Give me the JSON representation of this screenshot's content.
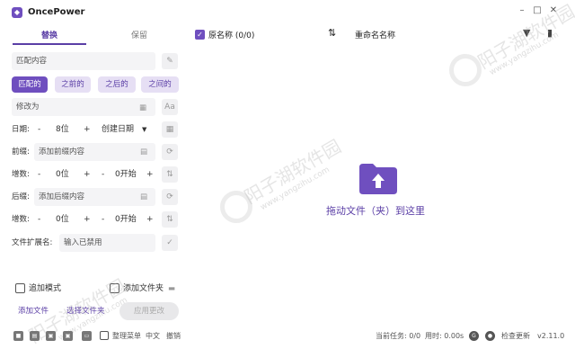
{
  "app": {
    "title": "OncePower"
  },
  "tabs": [
    "替换",
    "保留"
  ],
  "left": {
    "match_placeholder": "匹配内容",
    "mode_buttons": [
      "匹配的",
      "之前的",
      "之后的",
      "之间的"
    ],
    "modify_placeholder": "修改为",
    "date": {
      "label": "日期:",
      "minus": "-",
      "value": "8位",
      "plus": "+",
      "select": "创建日期"
    },
    "prefix": {
      "label": "前缀:",
      "placeholder": "添加前缀内容"
    },
    "increment1": {
      "label": "增数:",
      "minus1": "-",
      "value1": "0位",
      "plus1": "+",
      "minus2": "-",
      "value2": "0开始",
      "plus2": "+"
    },
    "suffix": {
      "label": "后缀:",
      "placeholder": "添加后缀内容"
    },
    "increment2": {
      "label": "增数:",
      "minus1": "-",
      "value1": "0位",
      "plus1": "+",
      "minus2": "-",
      "value2": "0开始",
      "plus2": "+"
    },
    "extension": {
      "label": "文件扩展名:",
      "placeholder": "输入已禁用"
    },
    "append_mode": "追加模式",
    "add_folder": "添加文件夹",
    "add_file": "添加文件",
    "select_folder": "选择文件夹",
    "apply": "应用更改"
  },
  "right": {
    "original_name": "原名称 (0/0)",
    "rename_name": "重命名名称",
    "drop_text": "拖动文件（夹）到这里"
  },
  "status": {
    "organize": "整理菜单",
    "language": "中文",
    "undo": "撤销",
    "current_task": "当前任务: 0/0",
    "time_used": "用时: 0.00s",
    "check_update": "检查更新",
    "version": "v2.11.0"
  },
  "watermark": {
    "text": "阳子湖软件园",
    "url": "www.yangzihu.com"
  },
  "colors": {
    "accent": "#6f4fbf",
    "accent_light": "#e6dff4"
  }
}
